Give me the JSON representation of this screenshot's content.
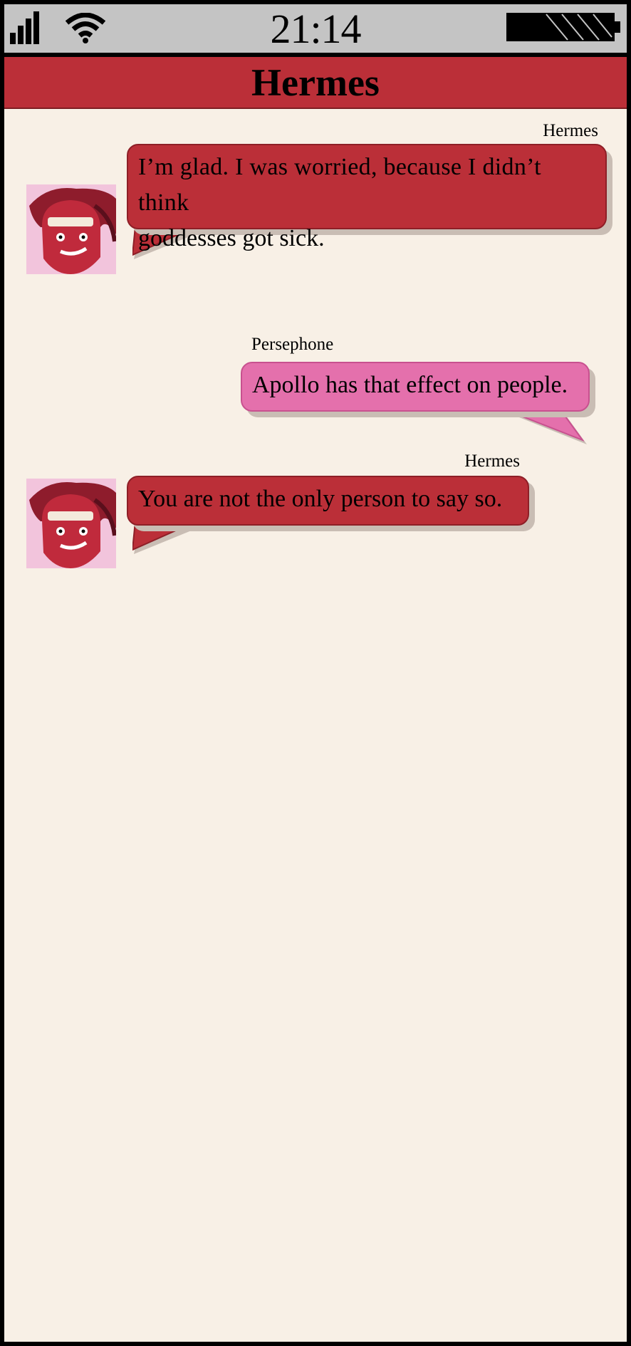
{
  "status_bar": {
    "time": "21:14",
    "signal_icon": "signal-bars-icon",
    "wifi_icon": "wifi-icon",
    "battery_icon": "battery-icon"
  },
  "header": {
    "title": "Hermes"
  },
  "colors": {
    "header_bg": "#bb2f38",
    "hermes_bubble": "#bb2f38",
    "persephone_bubble": "#e470ac",
    "background": "#f8f0e6",
    "status_bar_bg": "#c4c4c4"
  },
  "messages": [
    {
      "sender": "Hermes",
      "side": "left",
      "lines": [
        "I’m glad. I was worried, because I didn’t think",
        "goddesses got sick."
      ]
    },
    {
      "sender": "Persephone",
      "side": "right",
      "lines": [
        "Apollo has that effect on people."
      ]
    },
    {
      "sender": "Hermes",
      "side": "left",
      "lines": [
        "You are not the only person to say so."
      ]
    }
  ]
}
